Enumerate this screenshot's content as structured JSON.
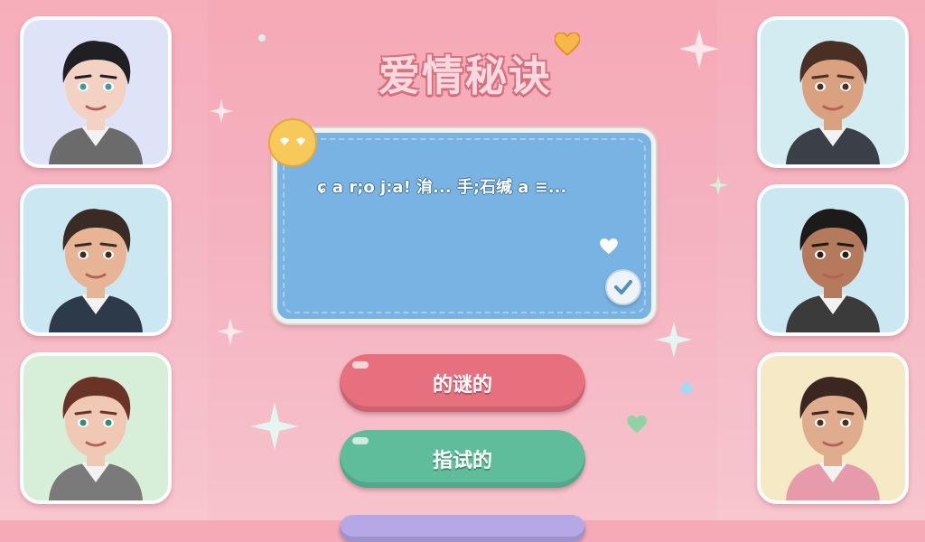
{
  "game": {
    "title": "爱情秘诀",
    "dialog": {
      "text": "ɕ a r;o j:a!  㳙...  手;石缄 a ≡..."
    },
    "choices": [
      {
        "label": "的谜的"
      },
      {
        "label": "指试的"
      },
      {
        "label": ""
      }
    ]
  },
  "characters": {
    "left": [
      {
        "hair": "#1f1f24",
        "skin": "#f3d2c4",
        "eyes": "#3b9aa8",
        "shirt": "#6b6b6b",
        "bg": "#dfe3f7"
      },
      {
        "hair": "#3a2b25",
        "skin": "#e7b595",
        "eyes": "#3a2b25",
        "shirt": "#2c3a4a",
        "bg": "#cbe7f1"
      },
      {
        "hair": "#6a3328",
        "skin": "#f0c9b5",
        "eyes": "#2d8c7c",
        "shirt": "#7a7a7a",
        "bg": "#d7efd9"
      }
    ],
    "right": [
      {
        "hair": "#4a3024",
        "skin": "#d9a17f",
        "eyes": "#4a3024",
        "shirt": "#3a3f48",
        "bg": "#d2ecf2"
      },
      {
        "hair": "#1d1a1a",
        "skin": "#b57a5c",
        "eyes": "#2a1c17",
        "shirt": "#3b3b3b",
        "bg": "#cbe7f1"
      },
      {
        "hair": "#3c2620",
        "skin": "#e0ac8e",
        "eyes": "#4a2c22",
        "shirt": "#e79aa9",
        "bg": "#f5e9c6"
      }
    ]
  },
  "icons": {
    "title_heart": "heart-icon",
    "badge": "smiley-badge-icon",
    "confirm": "check-icon"
  },
  "colors": {
    "background": "#f6a9b6",
    "dialog": "#78b3e3",
    "choice_primary": "#e7707f",
    "choice_secondary": "#5fbd9c",
    "choice_tertiary": "#b6a7e6"
  }
}
